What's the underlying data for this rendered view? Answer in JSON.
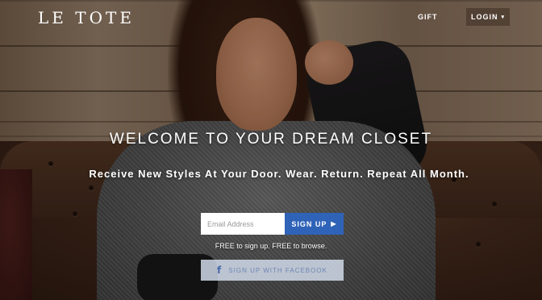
{
  "header": {
    "logo": "LE TOTE",
    "nav": {
      "gift_label": "GIFT",
      "login_label": "LOGIN",
      "login_caret": "▾"
    }
  },
  "hero": {
    "headline": "WELCOME TO YOUR DREAM CLOSET",
    "subheadline": "Receive New Styles At Your Door. Wear. Return. Repeat All Month."
  },
  "signup": {
    "email_placeholder": "Email Address",
    "button_label": "SIGN UP",
    "button_arrow": "▶",
    "free_text": "FREE to sign up. FREE to browse.",
    "facebook_label": "SIGN UP WITH FACEBOOK",
    "facebook_icon": "f"
  },
  "colors": {
    "signup_button": "#2f63b8",
    "facebook_text": "#6d86b4"
  }
}
